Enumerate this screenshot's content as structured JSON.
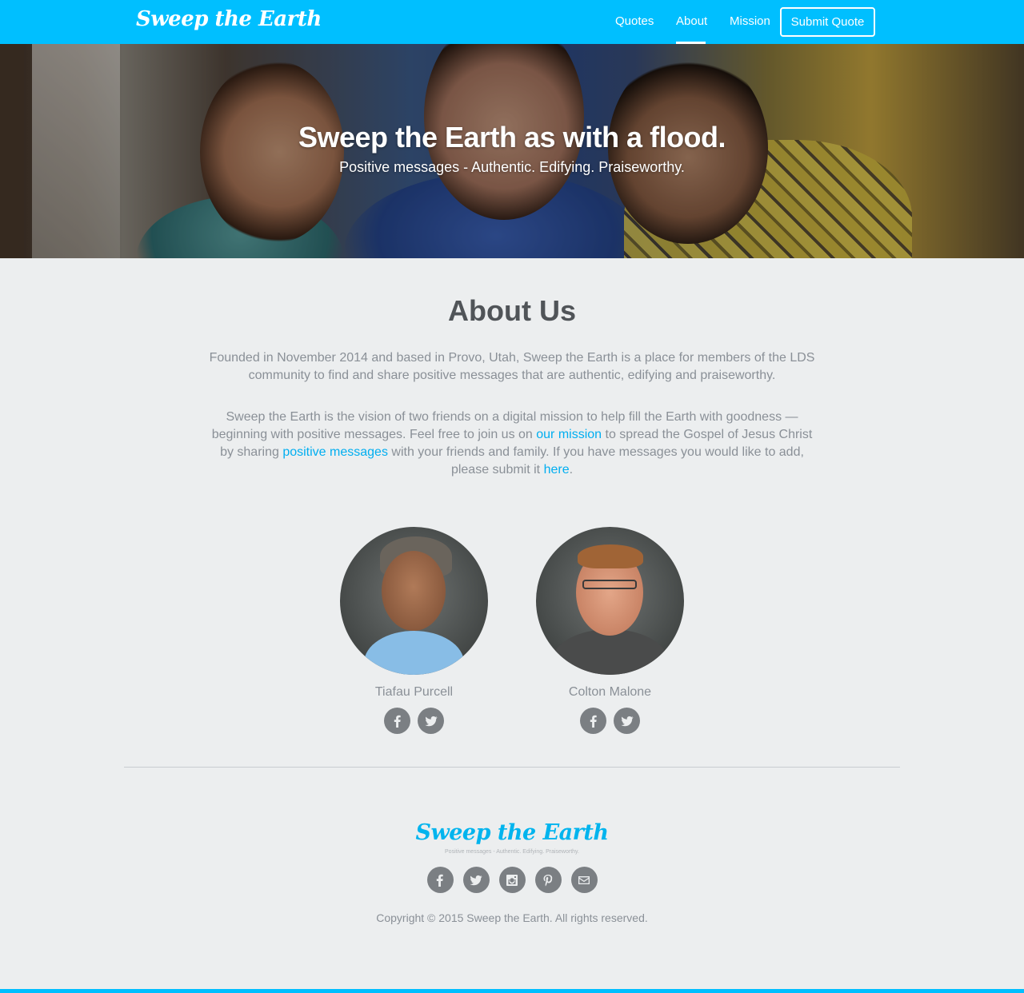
{
  "nav": {
    "brand": "Sweep the Earth",
    "links": [
      {
        "label": "Quotes"
      },
      {
        "label": "About"
      },
      {
        "label": "Mission"
      }
    ],
    "submit_label": "Submit Quote"
  },
  "hero": {
    "title": "Sweep the Earth as with a flood.",
    "subtitle": "Positive messages - Authentic. Edifying. Praiseworthy."
  },
  "about": {
    "title": "About Us",
    "p1": "Founded in November 2014 and based in Provo, Utah, Sweep the Earth is a place for members of the LDS community to find and share positive messages that are authentic, edifying and praiseworthy.",
    "p2_a": "Sweep the Earth is the vision of two friends on a digital mission to help fill the Earth with goodness — beginning with positive messages. Feel free to join us on ",
    "p2_link1": "our mission",
    "p2_b": " to spread the Gospel of Jesus Christ by sharing ",
    "p2_link2": "positive messages",
    "p2_c": " with your friends and family. If you have messages you would like to add, please submit it ",
    "p2_link3": "here",
    "p2_d": "."
  },
  "team": [
    {
      "name": "Tiafau Purcell",
      "socials": [
        "facebook-icon",
        "twitter-icon"
      ]
    },
    {
      "name": "Colton Malone",
      "socials": [
        "facebook-icon",
        "twitter-icon"
      ]
    }
  ],
  "footer": {
    "brand": "Sweep the Earth",
    "tagline": "Positive messages - Authentic. Edifying. Praiseworthy.",
    "socials": [
      "facebook-icon",
      "twitter-icon",
      "instagram-icon",
      "pinterest-icon",
      "email-icon"
    ],
    "copyright": "Copyright © 2015 Sweep the Earth. All rights reserved."
  },
  "colors": {
    "accent": "#00bfff",
    "link": "#00aef0",
    "background": "#eceeef",
    "heading": "#505458",
    "body_text": "#8a9097",
    "icon_bg": "#7b7f83"
  }
}
